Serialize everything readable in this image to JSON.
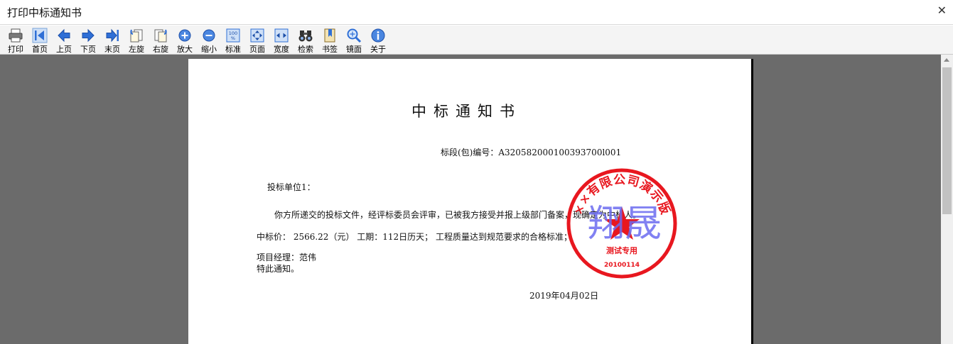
{
  "window": {
    "title": "打印中标通知书",
    "close_glyph": "✕"
  },
  "toolbar": {
    "buttons": [
      {
        "label": "打印",
        "icon": "printer-icon"
      },
      {
        "label": "首页",
        "icon": "first-page-icon"
      },
      {
        "label": "上页",
        "icon": "prev-page-icon"
      },
      {
        "label": "下页",
        "icon": "next-page-icon"
      },
      {
        "label": "末页",
        "icon": "last-page-icon"
      },
      {
        "label": "左旋",
        "icon": "rotate-left-icon"
      },
      {
        "label": "右旋",
        "icon": "rotate-right-icon"
      },
      {
        "label": "放大",
        "icon": "zoom-in-icon"
      },
      {
        "label": "缩小",
        "icon": "zoom-out-icon"
      },
      {
        "label": "标准",
        "icon": "actual-size-icon"
      },
      {
        "label": "页面",
        "icon": "fit-page-icon"
      },
      {
        "label": "宽度",
        "icon": "fit-width-icon"
      },
      {
        "label": "检索",
        "icon": "search-binoculars-icon"
      },
      {
        "label": "书签",
        "icon": "bookmark-icon"
      },
      {
        "label": "镜面",
        "icon": "magnifier-icon"
      },
      {
        "label": "关于",
        "icon": "info-icon"
      }
    ],
    "actual_size_text": "100\n%"
  },
  "document": {
    "title": "中标通知书",
    "section_number": "标段(包)编号：A320582000100393700l001",
    "addressee": "投标单位1：",
    "body": "你方所递交的投标文件，经评标委员会评审，已被我方接受并报上级部门备案，现确定为中标人。",
    "price_line": "中标价：   2566.22（元） 工期：112日历天；   工程质量达到规范要求的合格标准；",
    "manager": "项目经理：范伟",
    "closing": "特此通知。",
    "date": "2019年04月02日"
  },
  "seal": {
    "ring_text": "××有限公司演示版",
    "center_text": "测试专用",
    "serial": "20100114",
    "overlay_text": "翔晟",
    "color": "#e8171f",
    "overlay_color": "#6b6bf0"
  },
  "colors": {
    "viewer_bg": "#6b6b6b",
    "toolbar_bg": "#f4f4f4",
    "icon_blue": "#2f6fd6"
  }
}
